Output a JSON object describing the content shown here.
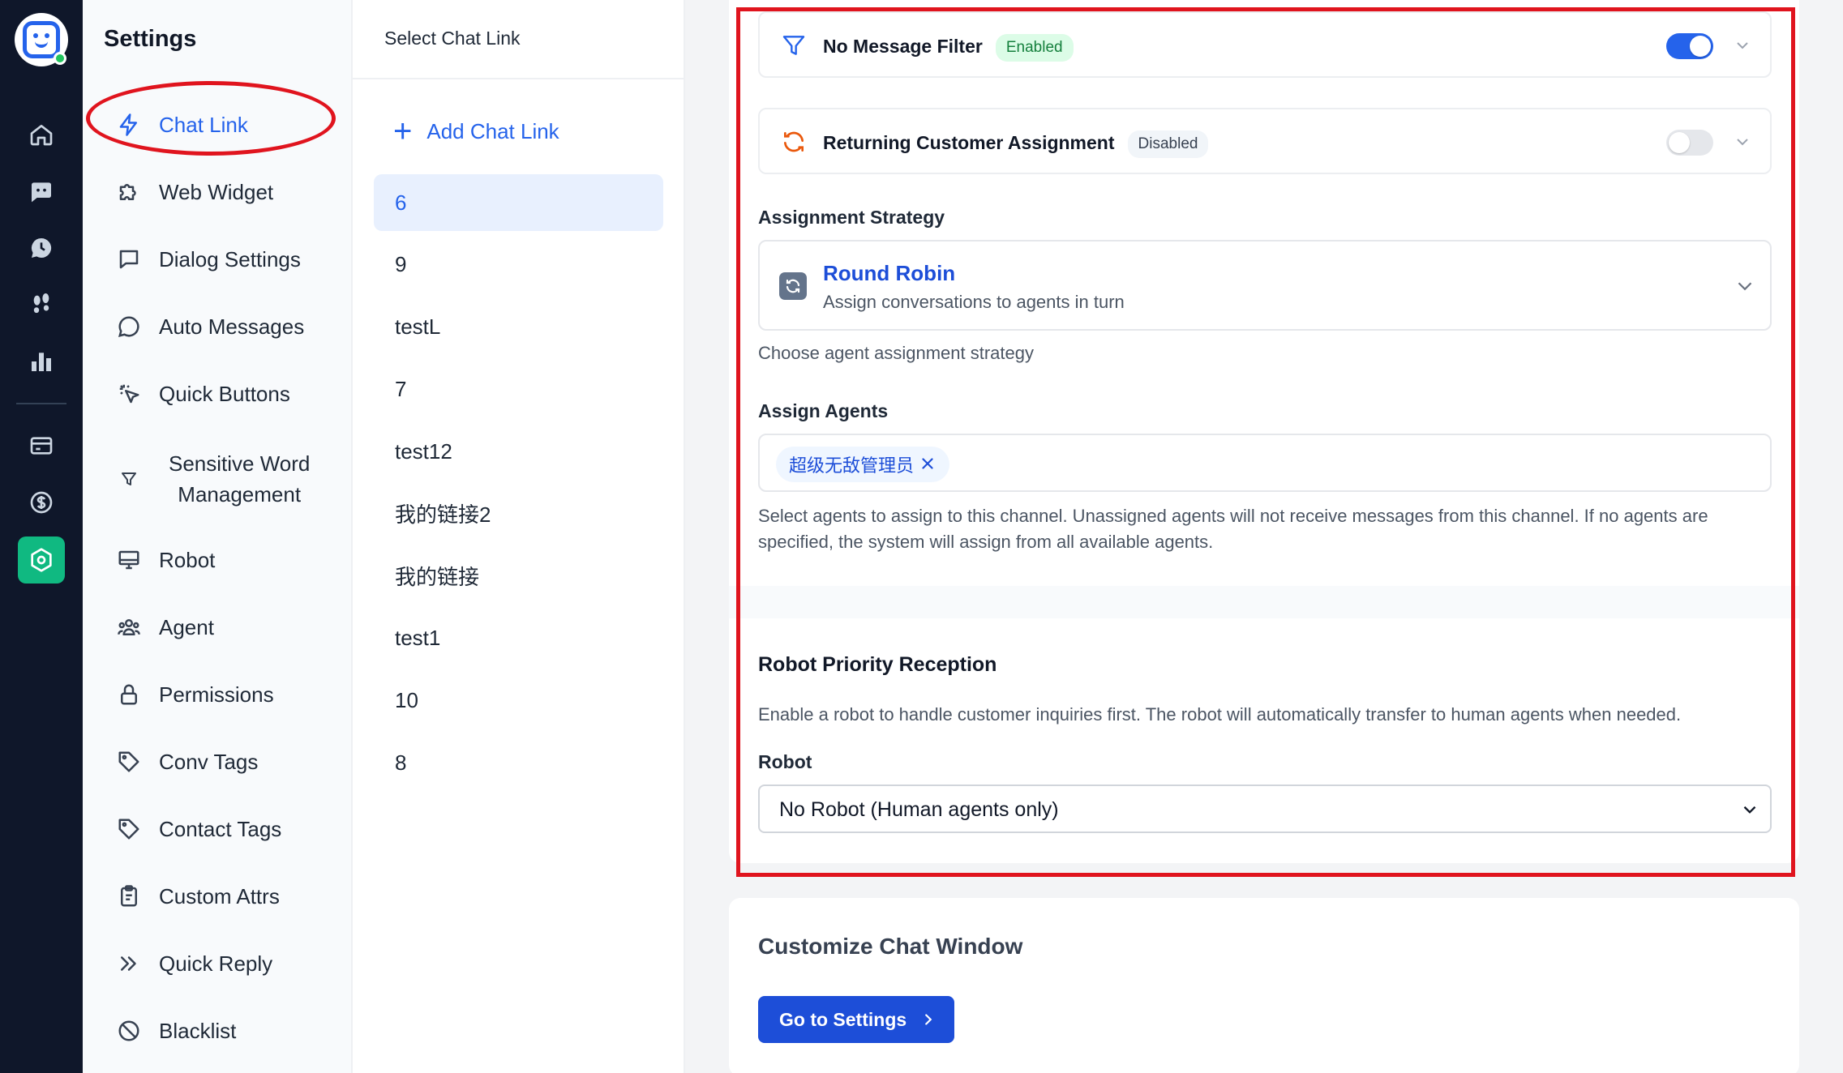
{
  "settings": {
    "title": "Settings",
    "items": [
      {
        "label": "Chat Link",
        "icon": "bolt-icon",
        "active": true
      },
      {
        "label": "Web Widget",
        "icon": "puzzle-icon"
      },
      {
        "label": "Dialog Settings",
        "icon": "message-square-icon"
      },
      {
        "label": "Auto Messages",
        "icon": "message-circle-icon"
      },
      {
        "label": "Quick Buttons",
        "icon": "pointer-click-icon"
      },
      {
        "label": "Sensitive Word",
        "label2": "Management",
        "icon": "filter-icon"
      },
      {
        "label": "Robot",
        "icon": "monitor-icon"
      },
      {
        "label": "Agent",
        "icon": "users-icon"
      },
      {
        "label": "Permissions",
        "icon": "lock-icon"
      },
      {
        "label": "Conv Tags",
        "icon": "tag-icon"
      },
      {
        "label": "Contact Tags",
        "icon": "tag-icon"
      },
      {
        "label": "Custom Attrs",
        "icon": "clipboard-icon"
      },
      {
        "label": "Quick Reply",
        "icon": "double-chevron-right-icon"
      },
      {
        "label": "Blacklist",
        "icon": "ban-icon"
      }
    ]
  },
  "links": {
    "header": "Select Chat Link",
    "add_label": "Add Chat Link",
    "items": [
      "6",
      "9",
      "testL",
      "7",
      "test12",
      "我的链接2",
      "我的链接",
      "test1",
      "10",
      "8"
    ],
    "active_index": 0
  },
  "main": {
    "no_message_filter": {
      "label": "No Message Filter",
      "badge": "Enabled",
      "on": true
    },
    "returning_customer": {
      "label": "Returning Customer Assignment",
      "badge": "Disabled",
      "on": false
    },
    "assignment_strategy": {
      "label": "Assignment Strategy",
      "selected_name": "Round Robin",
      "selected_desc": "Assign conversations to agents in turn",
      "help": "Choose agent assignment strategy"
    },
    "assign_agents": {
      "label": "Assign Agents",
      "chips": [
        "超级无敌管理员"
      ],
      "help_line1": "Select agents to assign to this channel. Unassigned agents will not receive messages from this channel. If no agents are",
      "help_line2": "specified, the system will assign from all available agents."
    },
    "robot_priority": {
      "title": "Robot Priority Reception",
      "desc": "Enable a robot to handle customer inquiries first. The robot will automatically transfer to human agents when needed.",
      "robot_label": "Robot",
      "robot_value": "No Robot (Human agents only)"
    },
    "customize": {
      "title": "Customize Chat Window",
      "button": "Go to Settings"
    }
  },
  "colors": {
    "rail_bg": "#0f172a",
    "accent": "#2563eb",
    "active_rail": "#10b981",
    "annotation_red": "#e0141e"
  }
}
